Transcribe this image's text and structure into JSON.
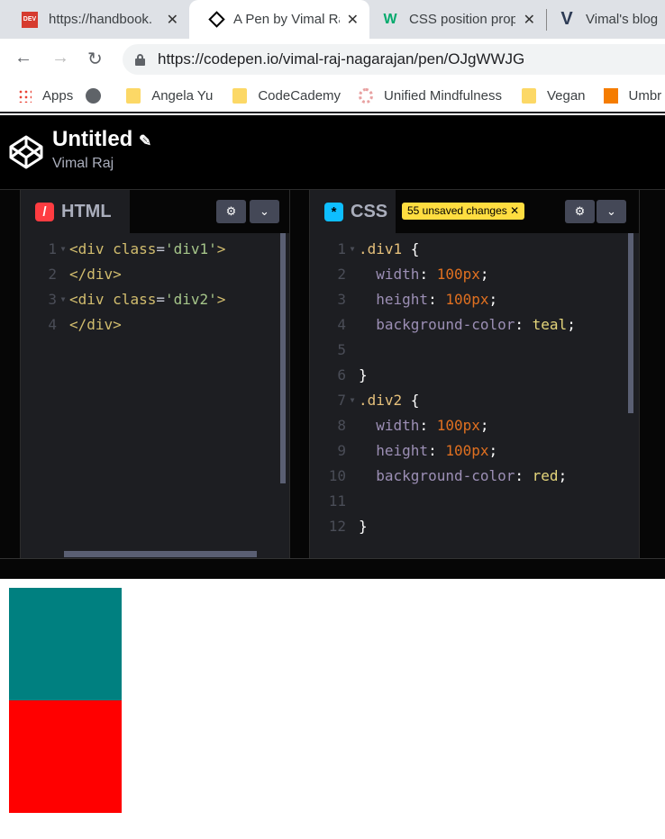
{
  "browser": {
    "tabs": [
      {
        "title": "https://handbook.",
        "icon": "dev-icon",
        "active": false
      },
      {
        "title": "A Pen by Vimal Raj",
        "icon": "codepen-icon",
        "active": true
      },
      {
        "title": "CSS position prop",
        "icon": "w3schools-icon",
        "active": false
      },
      {
        "title": "Vimal's blog",
        "icon": "v-icon",
        "active": false
      }
    ],
    "url": "https://codepen.io/vimal-raj-nagarajan/pen/OJgWWJG",
    "bookmarks": [
      "Apps",
      "",
      "Angela Yu",
      "CodeCademy",
      "Unified Mindfulness",
      "Vegan",
      "Umbr"
    ]
  },
  "pen": {
    "title": "Untitled",
    "author": "Vimal Raj"
  },
  "html_panel": {
    "label": "HTML",
    "icon_glyph": "/",
    "color": "#ff3c41",
    "lines": [
      [
        [
          "<div ",
          "#d2bd6e"
        ],
        [
          "class",
          "#d2bd6e"
        ],
        [
          "=",
          "#c5c8d4"
        ],
        [
          "'div1'",
          "#a6c68a"
        ],
        [
          ">",
          "#d2bd6e"
        ]
      ],
      [
        [
          "</div>",
          "#d2bd6e"
        ]
      ],
      [
        [
          "<div ",
          "#d2bd6e"
        ],
        [
          "class",
          "#d2bd6e"
        ],
        [
          "=",
          "#c5c8d4"
        ],
        [
          "'div2'",
          "#a6c68a"
        ],
        [
          ">",
          "#d2bd6e"
        ]
      ],
      [
        [
          "</div>",
          "#d2bd6e"
        ]
      ]
    ],
    "folds": [
      true,
      false,
      true,
      false
    ]
  },
  "css_panel": {
    "label": "CSS",
    "icon_glyph": "*",
    "color": "#0ebeff",
    "unsaved": "55 unsaved changes",
    "lines": [
      [
        [
          ".div1 ",
          "#e5c07b"
        ],
        [
          "{",
          "#fff"
        ]
      ],
      [
        [
          "  width",
          "#9c8fb5"
        ],
        [
          ": ",
          "#fff"
        ],
        [
          "100px",
          "#e07020"
        ],
        [
          ";",
          "#fff"
        ]
      ],
      [
        [
          "  height",
          "#9c8fb5"
        ],
        [
          ": ",
          "#fff"
        ],
        [
          "100px",
          "#e07020"
        ],
        [
          ";",
          "#fff"
        ]
      ],
      [
        [
          "  background-color",
          "#9c8fb5"
        ],
        [
          ": ",
          "#fff"
        ],
        [
          "teal",
          "#e5d67b"
        ],
        [
          ";",
          "#fff"
        ]
      ],
      [],
      [
        [
          "}",
          "#fff"
        ]
      ],
      [
        [
          ".div2 ",
          "#e5c07b"
        ],
        [
          "{",
          "#fff"
        ]
      ],
      [
        [
          "  width",
          "#9c8fb5"
        ],
        [
          ": ",
          "#fff"
        ],
        [
          "100px",
          "#e07020"
        ],
        [
          ";",
          "#fff"
        ]
      ],
      [
        [
          "  height",
          "#9c8fb5"
        ],
        [
          ": ",
          "#fff"
        ],
        [
          "100px",
          "#e07020"
        ],
        [
          ";",
          "#fff"
        ]
      ],
      [
        [
          "  background-color",
          "#9c8fb5"
        ],
        [
          ": ",
          "#fff"
        ],
        [
          "red",
          "#e5d67b"
        ],
        [
          ";",
          "#fff"
        ]
      ],
      [],
      [
        [
          "}",
          "#fff"
        ]
      ]
    ],
    "folds": [
      true,
      false,
      false,
      false,
      false,
      false,
      true,
      false,
      false,
      false,
      false,
      false
    ]
  },
  "preview": {
    "box1": "#008080",
    "box2": "#ff0000"
  }
}
